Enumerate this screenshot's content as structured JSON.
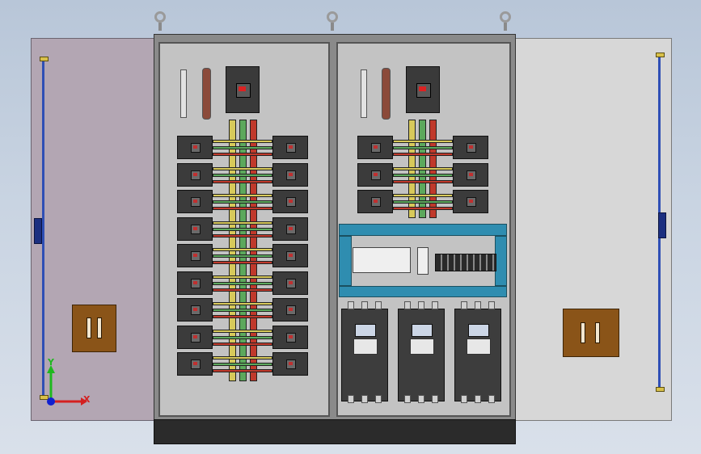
{
  "scene": {
    "caption": "",
    "left_door": {
      "handle": "door-handle-left"
    },
    "right_door": {
      "handle": "door-handle-right"
    },
    "cabinets": [
      {
        "name": "left-section",
        "breaker_rows": 9
      },
      {
        "name": "right-section",
        "breaker_rows": 3,
        "drives": 3
      }
    ]
  },
  "triad": {
    "x_label": "X",
    "y_label": "Y",
    "x_color": "#d42020",
    "y_color": "#1fb81f",
    "z_color": "#1020d0"
  },
  "colors": {
    "bus_yellow": "#d7c95a",
    "bus_green": "#5ca85c",
    "bus_red": "#c0392b",
    "door_left": "#b3a6b3",
    "door_right": "#d7d7d7",
    "handle": "#8a5418",
    "duct": "#2f8db0"
  }
}
